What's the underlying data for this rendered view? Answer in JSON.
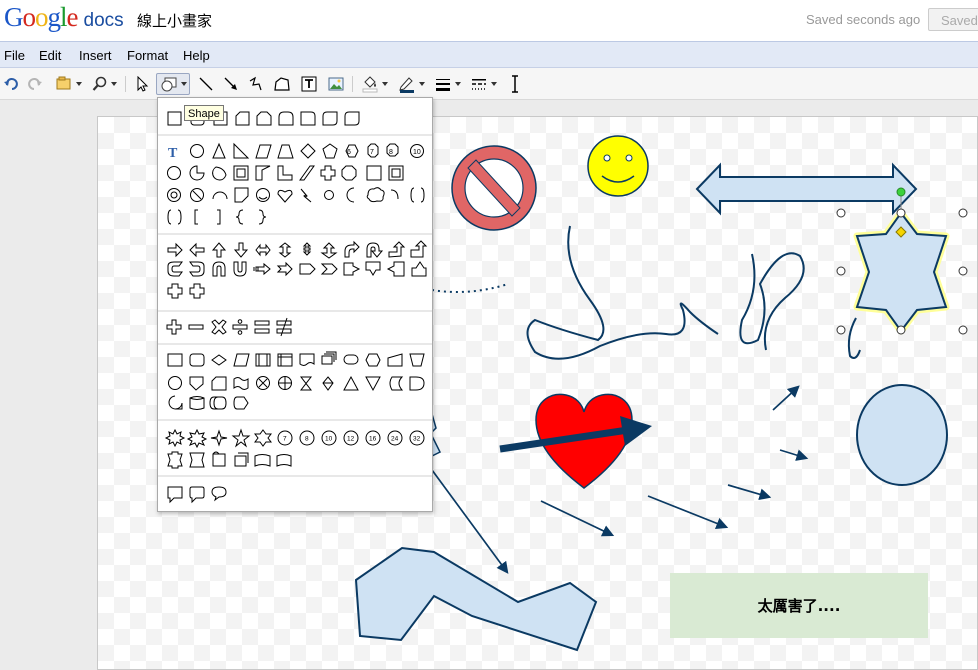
{
  "app": {
    "logo_google": "Google",
    "logo_docs": "docs",
    "document_title": "線上小畫家",
    "save_status": "Saved seconds ago",
    "saved_button_label": "Saved"
  },
  "menu": {
    "items": [
      "File",
      "Edit",
      "Insert",
      "Format",
      "Help"
    ]
  },
  "toolbar": {
    "tools": [
      "undo-icon",
      "redo-icon",
      "paint-format-icon",
      "zoom-icon",
      "select-arrow-icon",
      "shape-icon",
      "line-icon",
      "arrow-icon",
      "polyline-icon",
      "freeform-icon",
      "text-box-icon",
      "image-icon",
      "fill-color-icon",
      "line-color-icon",
      "line-weight-icon",
      "line-dash-icon",
      "text-cursor-icon"
    ],
    "active_tool": "shape"
  },
  "tooltip": {
    "text": "Shape"
  },
  "shape_menu": {
    "sections": [
      {
        "name": "rectangles",
        "count": 9
      },
      {
        "name": "basic-shapes",
        "count": 48
      },
      {
        "name": "block-arrows",
        "count": 24
      },
      {
        "name": "equation-shapes",
        "count": 6
      },
      {
        "name": "flowchart",
        "count": 28
      },
      {
        "name": "stars-banners",
        "count": 18
      },
      {
        "name": "callouts",
        "count": 3
      }
    ]
  },
  "canvas": {
    "text_box_label": "太厲害了....",
    "colors": {
      "shape_fill": "#cfe2f3",
      "shape_stroke": "#0b3a63",
      "no_sign": "#e06666",
      "smiley": "#ffff00",
      "heart": "#ff0000",
      "text_box_fill": "#d9ead3",
      "selection_glow": "#ffff99"
    }
  }
}
